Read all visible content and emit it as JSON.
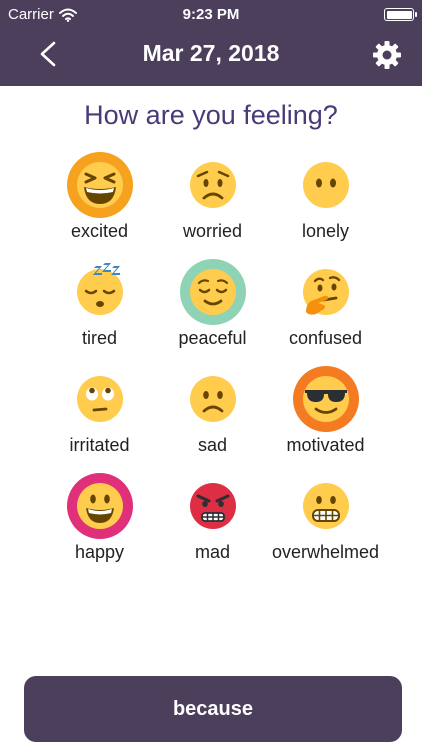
{
  "status_bar": {
    "carrier": "Carrier",
    "time": "9:23 PM",
    "battery_level": 1.0,
    "wifi_icon": "wifi-icon"
  },
  "nav": {
    "title": "Mar 27, 2018",
    "back_icon": "chevron-left-icon",
    "settings_icon": "gear-icon"
  },
  "question": "How are you feeling?",
  "moods": [
    {
      "label": "excited",
      "icon": "grinning-squinting-face-icon",
      "highlight": "#f6a21e"
    },
    {
      "label": "worried",
      "icon": "worried-face-icon",
      "highlight": null
    },
    {
      "label": "lonely",
      "icon": "face-without-mouth-icon",
      "highlight": null
    },
    {
      "label": "tired",
      "icon": "sleeping-face-icon",
      "highlight": null
    },
    {
      "label": "peaceful",
      "icon": "relieved-face-icon",
      "highlight": "#8fd3b6"
    },
    {
      "label": "confused",
      "icon": "thinking-face-icon",
      "highlight": null
    },
    {
      "label": "irritated",
      "icon": "eye-roll-face-icon",
      "highlight": null
    },
    {
      "label": "sad",
      "icon": "sad-face-icon",
      "highlight": null
    },
    {
      "label": "motivated",
      "icon": "sunglasses-face-icon",
      "highlight": "#f47b21"
    },
    {
      "label": "happy",
      "icon": "smiling-face-icon",
      "highlight": "#e0307a"
    },
    {
      "label": "mad",
      "icon": "angry-face-icon",
      "highlight": null
    },
    {
      "label": "overwhelmed",
      "icon": "grimacing-face-icon",
      "highlight": null
    }
  ],
  "colors": {
    "primary": "#4b3f5c",
    "question_text": "#4b3a78",
    "emoji_yellow": "#ffcc4d",
    "emoji_red": "#dd2e44"
  },
  "footer": {
    "button_label": "because"
  }
}
